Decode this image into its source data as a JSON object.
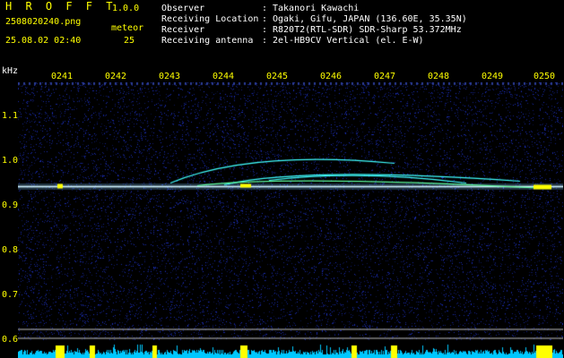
{
  "header": {
    "app_title": "H R O F F T",
    "app_version": "1.0.0",
    "filename": "2508020240.png",
    "meteor_label": "meteor",
    "timestamp": "25.08.02 02:40",
    "meteor_count": "25"
  },
  "info": [
    {
      "key": "Observer",
      "value": "Takanori Kawachi"
    },
    {
      "key": "Receiving Location",
      "value": "Ogaki, Gifu, JAPAN (136.60E, 35.35N)"
    },
    {
      "key": "Receiver",
      "value": "R820T2(RTL-SDR) SDR-Sharp 53.372MHz"
    },
    {
      "key": "Receiving antenna",
      "value": "2el-HB9CV Vertical (el. E-W)"
    }
  ],
  "chart_data": {
    "type": "heatmap",
    "xlabel": "",
    "ylabel": "kHz",
    "x_ticks": [
      "0241",
      "0242",
      "0243",
      "0244",
      "0245",
      "0246",
      "0247",
      "0248",
      "0249",
      "0250"
    ],
    "y_ticks": [
      "1.1",
      "1.0",
      "0.9",
      "0.8",
      "0.7",
      "0.6"
    ],
    "ylim": [
      0.58,
      1.2
    ],
    "carrier_khz": 0.945,
    "reference_lines_khz": [
      0.625,
      0.605
    ],
    "colors": {
      "background": "#000000",
      "noise": "#1020a0",
      "signal": "#40ffff",
      "peak": "#ffff00",
      "carrier": "#c8f0ff"
    }
  }
}
